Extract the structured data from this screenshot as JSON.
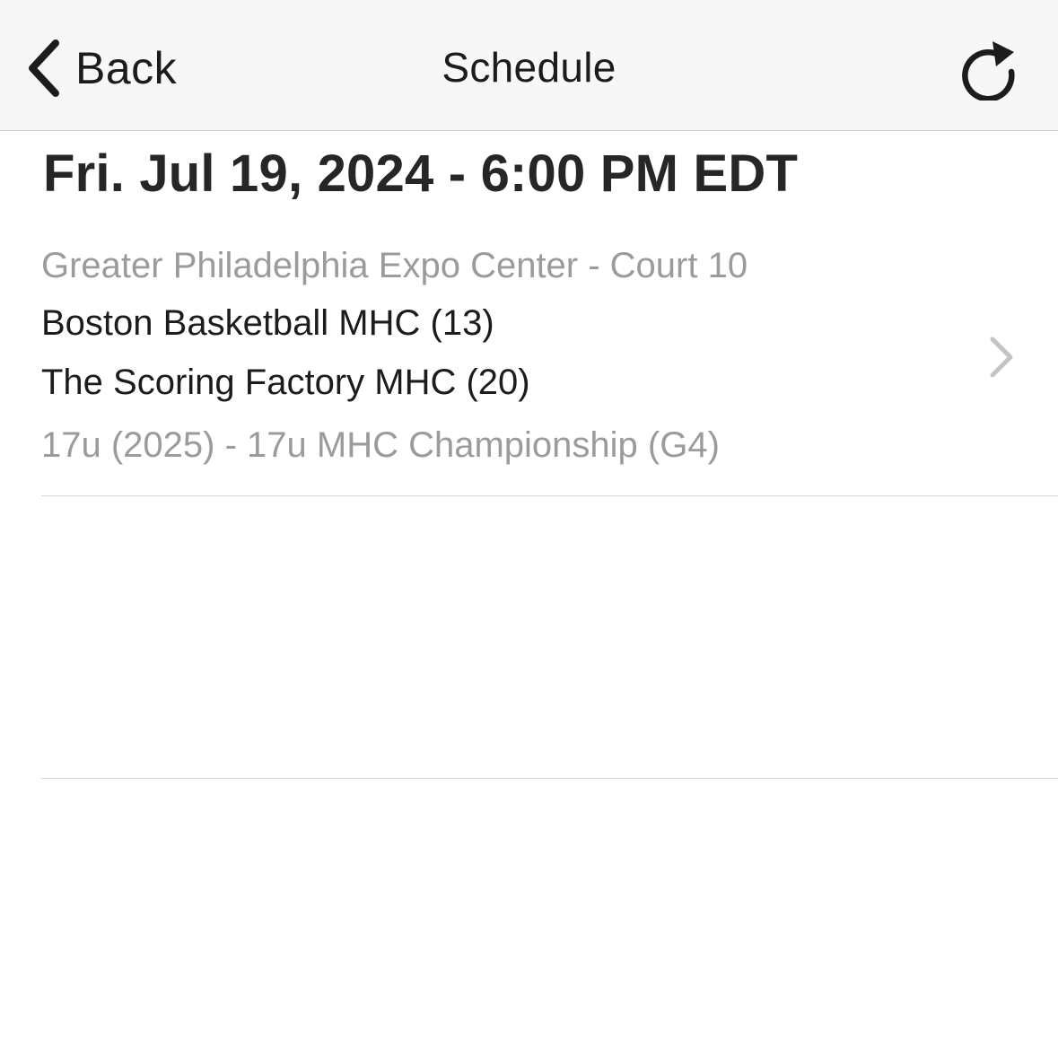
{
  "navbar": {
    "back_label": "Back",
    "back_icon": "chevron-left-icon",
    "title": "Schedule",
    "refresh_icon": "refresh-icon"
  },
  "schedule": {
    "date_header": "Fri. Jul 19, 2024 - 6:00 PM EDT",
    "games": [
      {
        "venue": "Greater Philadelphia Expo Center - Court 10",
        "team1": "Boston Basketball MHC (13)",
        "team2": "The Scoring Factory MHC (20)",
        "division": "17u (2025) - 17u MHC Championship (G4)",
        "disclosure_icon": "chevron-right-icon"
      }
    ]
  },
  "colors": {
    "navbar_bg": "#f7f7f7",
    "primary_text": "#1c1c1c",
    "secondary_text": "#9b9b9b",
    "separator": "#d6d6d6"
  }
}
